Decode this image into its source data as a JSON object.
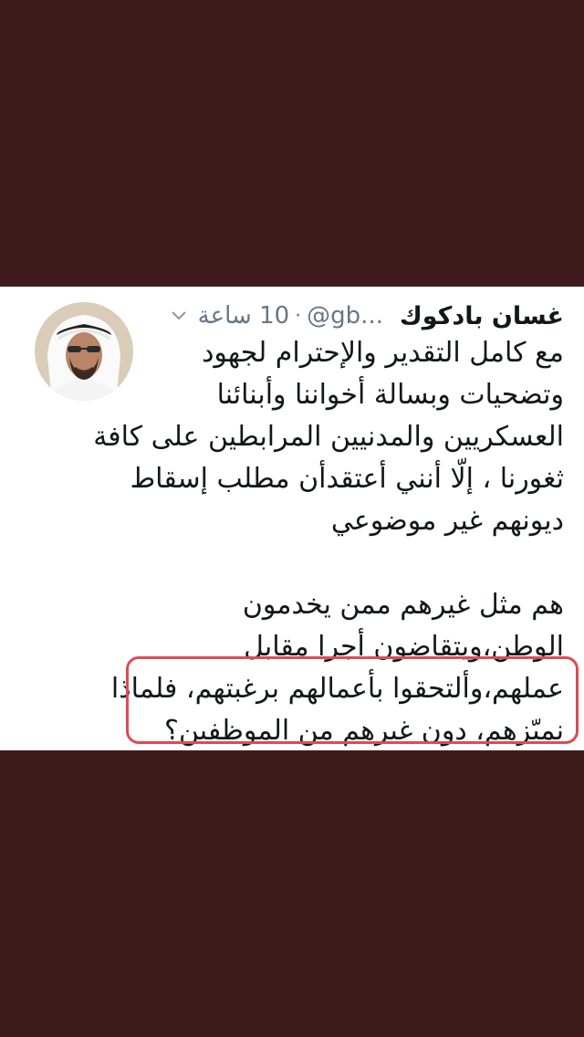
{
  "tweet": {
    "author": {
      "display_name": "غسان بادكوك",
      "handle": "@gb...",
      "avatar_icon": "profile-photo"
    },
    "separator": "·",
    "time": "10 ساعة",
    "menu_icon": "chevron-down-icon",
    "lines_part1": [
      "مع كامل التقدير والإحترام لجهود",
      "وتضحيات وبسالة أخواننا وأبنائنا",
      "العسكريين والمدنيين المرابطين على كافة",
      "ثغورنا ، إلّا أنني أعتقدأن مطلب إسقاط",
      "ديونهم غير موضوعي"
    ],
    "lines_part2": [
      "هم مثل غيرهم ممن يخدمون",
      "الوطن،ويتقاضون أجرا مقابل"
    ],
    "highlighted_lines": [
      "عملهم،وألتحقوا بأعمالهم برغبتهم، فلماذا",
      "نميّزهم، دون غيرهم من الموظفين؟"
    ],
    "highlight_color": "#dc4c54"
  },
  "colors": {
    "background": "#3e1c1d",
    "card": "#ffffff",
    "text": "#14171a",
    "secondary_text": "#657786"
  }
}
